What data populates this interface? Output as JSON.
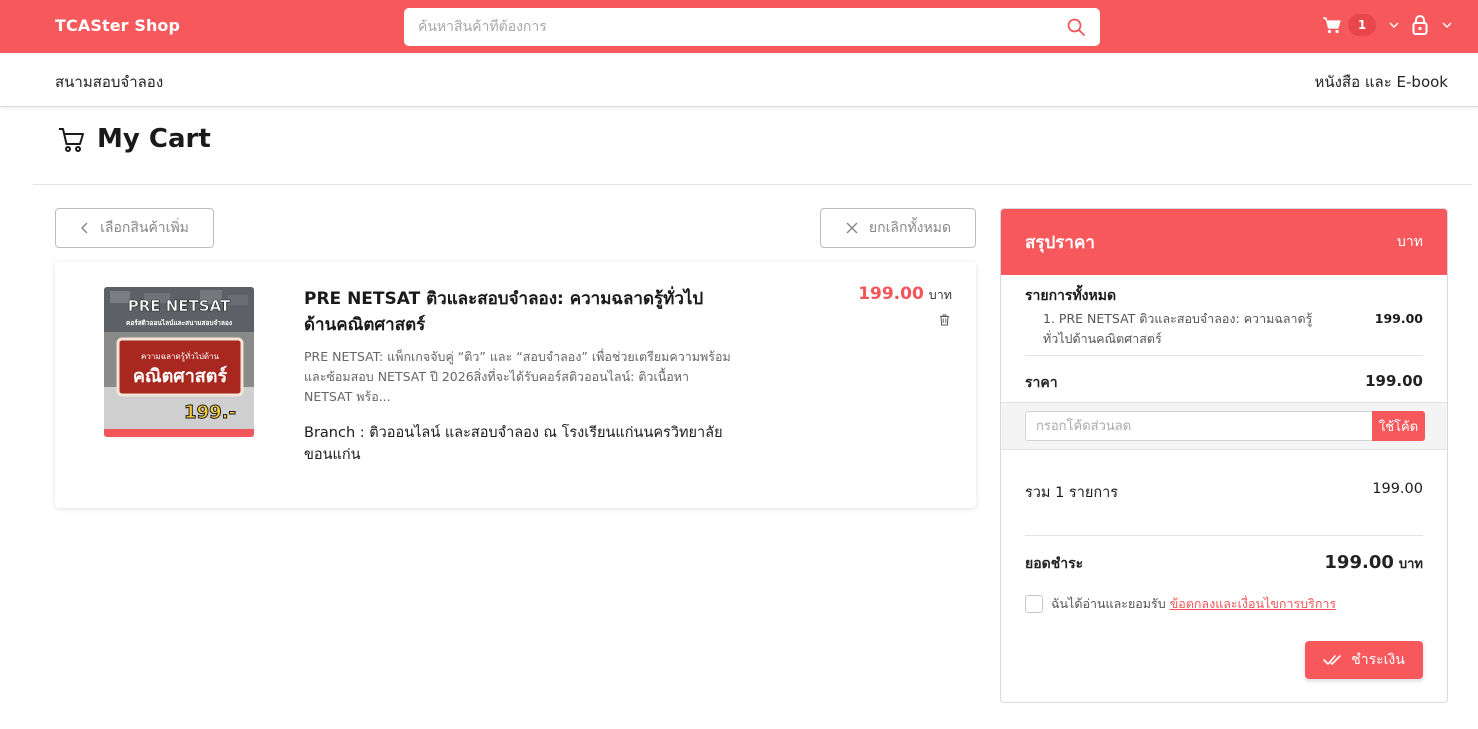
{
  "header": {
    "brand": "TCASter Shop",
    "search_placeholder": "ค้นหาสินค้าที่ต้องการ",
    "cart_count": "1"
  },
  "subnav": {
    "left": "สนามสอบจำลอง",
    "right": "หนังสือ และ E-book"
  },
  "page": {
    "title": "My Cart"
  },
  "actions": {
    "back_label": "เลือกสินค้าเพิ่ม",
    "clear_label": "ยกเลิกทั้งหมด"
  },
  "cart": {
    "items": [
      {
        "title": "PRE NETSAT ติวและสอบจำลอง: ความฉลาดรู้ทั่วไปด้านคณิตศาสตร์",
        "description": "PRE NETSAT: แพ็กเกจจับคู่ “ติว” และ “สอบจำลอง” เพื่อช่วยเตรียมความพร้อมและซ้อมสอบ NETSAT ปี 2026สิ่งที่จะได้รับคอร์สติวออนไลน์: ติวเนื้อหา NETSAT พร้อ...",
        "branch": "Branch : ติวออนไลน์ และสอบจำลอง ณ โรงเรียนแก่นนครวิทยาลัย ขอนแก่น",
        "price": "199.00",
        "currency": "บาท",
        "thumb": {
          "brand": "PRE NETSAT",
          "tagline": "คอร์สติวออนไลน์และสนามสอบจำลอง",
          "subject_small": "ความฉลาดรู้ทั่วไปด้าน",
          "subject_big": "คณิตศาสตร์",
          "price_tag": "199.-"
        }
      }
    ]
  },
  "summary": {
    "title": "สรุปราคา",
    "unit": "บาท",
    "all_items_label": "รายการทั้งหมด",
    "line_items": [
      {
        "index": "1.",
        "name": "PRE NETSAT ติวและสอบจำลอง: ความฉลาดรู้ทั่วไปด้านคณิตศาสตร์",
        "price": "199.00"
      }
    ],
    "price_label": "ราคา",
    "price_value": "199.00",
    "coupon_placeholder": "กรอกโค้ดส่วนลด",
    "coupon_button": "ใช้โค้ด",
    "count_label": "รวม 1 รายการ",
    "count_value": "199.00",
    "total_label": "ยอดชำระ",
    "total_value": "199.00",
    "total_currency": "บาท",
    "agree_text": "ฉันได้อ่านและยอมรับ",
    "agree_link": "ข้อตกลงและเงื่อนไขการบริการ",
    "pay_button": "ชำระเงิน"
  },
  "colors": {
    "brand": "#f6585c",
    "price": "#f2565a"
  }
}
